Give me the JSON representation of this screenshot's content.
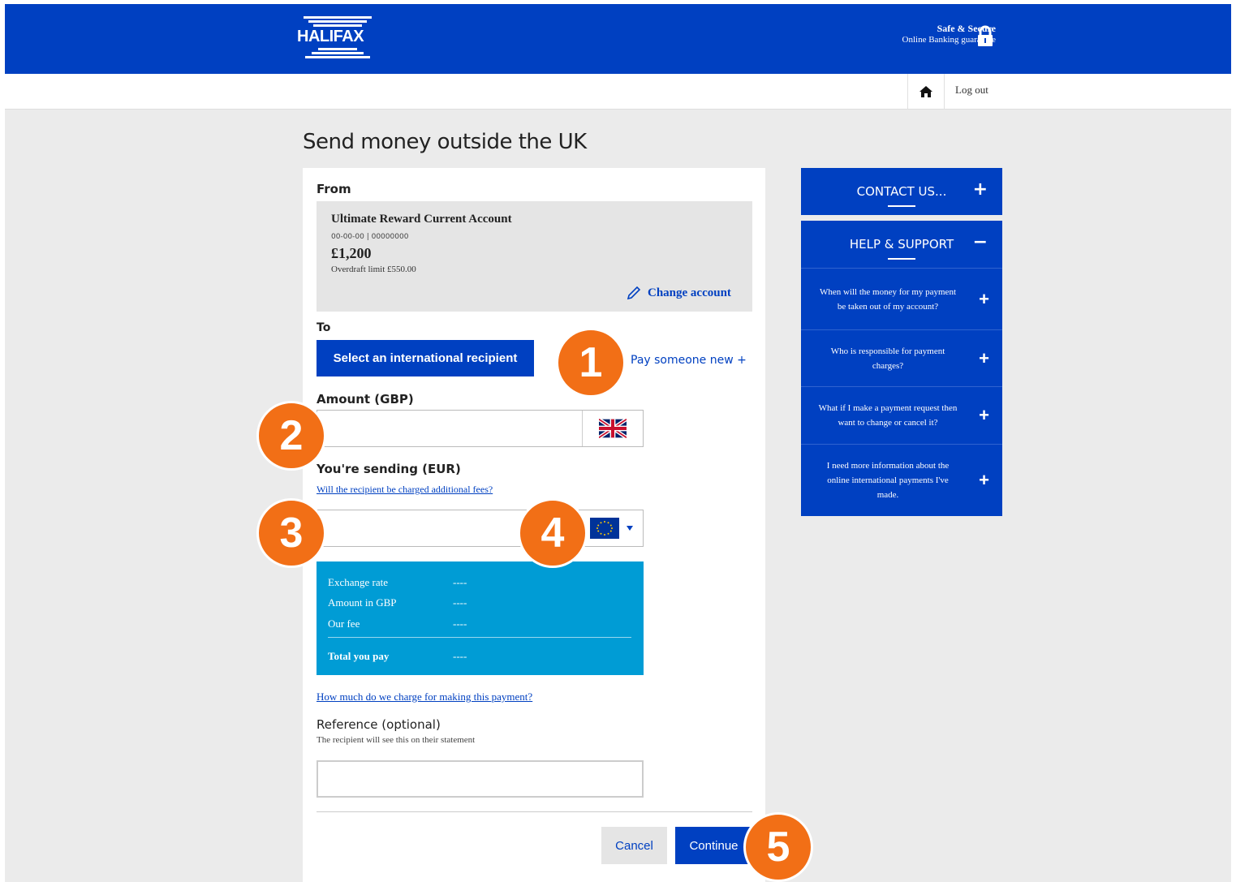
{
  "header": {
    "brand": "HALIFAX",
    "secure_line1": "Safe & Secure",
    "secure_line2": "Online Banking guarantee",
    "color": "#0040c1"
  },
  "subnav": {
    "home_icon": "home-icon",
    "logout_label": "Log out"
  },
  "page_title": "Send money outside the UK",
  "from": {
    "label": "From",
    "account_name": "Ultimate Reward Current Account",
    "account_number": "00-00-00 | 00000000",
    "balance": "£1,200",
    "overdraft": "Overdraft limit £550.00",
    "change_label": "Change account"
  },
  "to": {
    "label": "To",
    "select_button": "Select an international recipient",
    "pay_new": "Pay someone new +"
  },
  "amount": {
    "label": "Amount (GBP)",
    "value": "",
    "flag_icon": "uk-flag-icon"
  },
  "sending": {
    "label": "You're sending (EUR)",
    "fees_link": "Will the recipient be charged additional fees?",
    "value": "",
    "flag_icon": "eu-flag-icon"
  },
  "rates": {
    "exchange_rate_label": "Exchange rate",
    "exchange_rate_value": "----",
    "amount_gbp_label": "Amount in GBP",
    "amount_gbp_value": "----",
    "fee_label": "Our fee",
    "fee_value": "----",
    "total_label": "Total you pay",
    "total_value": "----",
    "color": "#009cd5"
  },
  "charge_link": "How much do we charge for making this payment?",
  "reference": {
    "label": "Reference (optional)",
    "hint": "The recipient will see this on their statement",
    "value": ""
  },
  "actions": {
    "cancel": "Cancel",
    "continue": "Continue"
  },
  "side": {
    "contact": {
      "title": "CONTACT US...",
      "sign": "+"
    },
    "help": {
      "title": "HELP & SUPPORT",
      "sign": "−",
      "items": [
        {
          "q": "When will the money for my payment be taken out of my account?",
          "sign": "+"
        },
        {
          "q": "Who is responsible for payment charges?",
          "sign": "+"
        },
        {
          "q": "What if I make a payment request then want to change or cancel it?",
          "sign": "+"
        },
        {
          "q": "I need more information about the online international payments I've made.",
          "sign": "+"
        }
      ]
    }
  },
  "callouts": [
    "1",
    "2",
    "3",
    "4",
    "5"
  ],
  "callout_color": "#f26f16"
}
